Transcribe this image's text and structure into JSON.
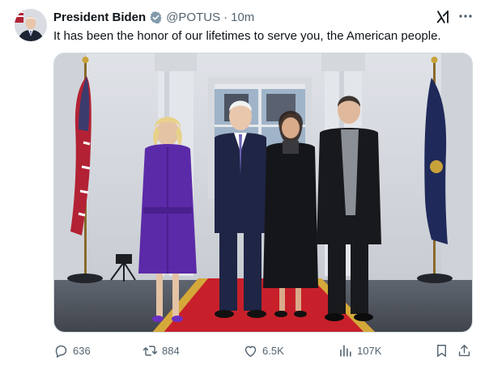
{
  "post": {
    "author_name": "President Biden",
    "handle": "@POTUS",
    "separator": "·",
    "time": "10m",
    "text": "It has been the honor of our lifetimes to serve you, the American people."
  },
  "icons": {
    "verified": "verified-badge-icon",
    "grok": "grok-icon",
    "more": "more-icon",
    "reply": "reply-icon",
    "repost": "repost-icon",
    "like": "heart-icon",
    "views": "views-icon",
    "bookmark": "bookmark-icon",
    "share": "share-icon"
  },
  "metrics": {
    "replies": "636",
    "reposts": "884",
    "likes": "6.5K",
    "views": "107K"
  },
  "colors": {
    "text_primary": "#0f1419",
    "text_secondary": "#536471",
    "verified": "#829aab",
    "border": "#cfd9de"
  }
}
